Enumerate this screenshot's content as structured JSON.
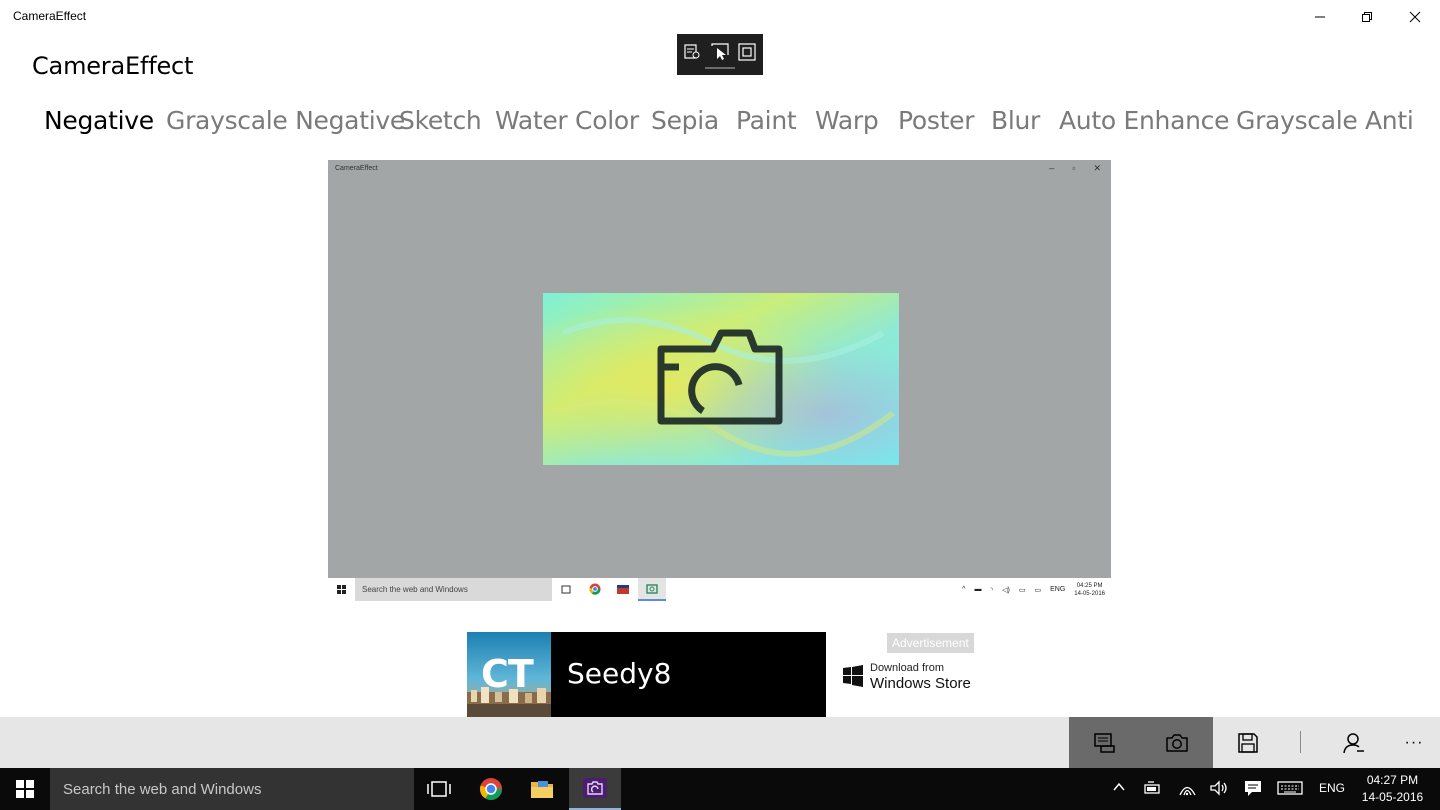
{
  "window": {
    "title": "CameraEffect",
    "controls": [
      "minimize",
      "restore",
      "close"
    ]
  },
  "capture_toolbar": {
    "icons": [
      "annotate-icon",
      "select-pointer-icon",
      "fullscreen-capture-icon"
    ]
  },
  "app": {
    "heading": "CameraEffect"
  },
  "effects_pivot": {
    "active_index": 0,
    "tabs": [
      {
        "label": "Negative"
      },
      {
        "label": "Grayscale Negative"
      },
      {
        "label": "Sketch"
      },
      {
        "label": "Water Color"
      },
      {
        "label": "Sepia"
      },
      {
        "label": "Paint"
      },
      {
        "label": "Warp"
      },
      {
        "label": "Poster"
      },
      {
        "label": "Blur"
      },
      {
        "label": "Auto Enhance"
      },
      {
        "label": "Grayscale"
      },
      {
        "label": "Anti"
      }
    ]
  },
  "preview": {
    "window_title": "CameraEffect",
    "search_placeholder": "Search the web and Windows",
    "language": "ENG",
    "time": "04:25 PM",
    "date": "14-05-2016",
    "background_color": "#a3a6a7"
  },
  "ad": {
    "label": "Advertisement",
    "logo_text": "CT",
    "brand": "Seedy8",
    "store_line1": "Download from",
    "store_line2": "Windows Store"
  },
  "app_bar": {
    "buttons": [
      "compare-icon",
      "camera-icon",
      "save-icon",
      "account-icon",
      "more-icon"
    ],
    "more_label": "···"
  },
  "taskbar": {
    "search_placeholder": "Search the web and Windows",
    "apps": [
      "task-view-icon",
      "chrome-icon",
      "file-explorer-icon",
      "camera-effect-app-icon"
    ],
    "language": "ENG",
    "time": "04:27 PM",
    "date": "14-05-2016"
  }
}
